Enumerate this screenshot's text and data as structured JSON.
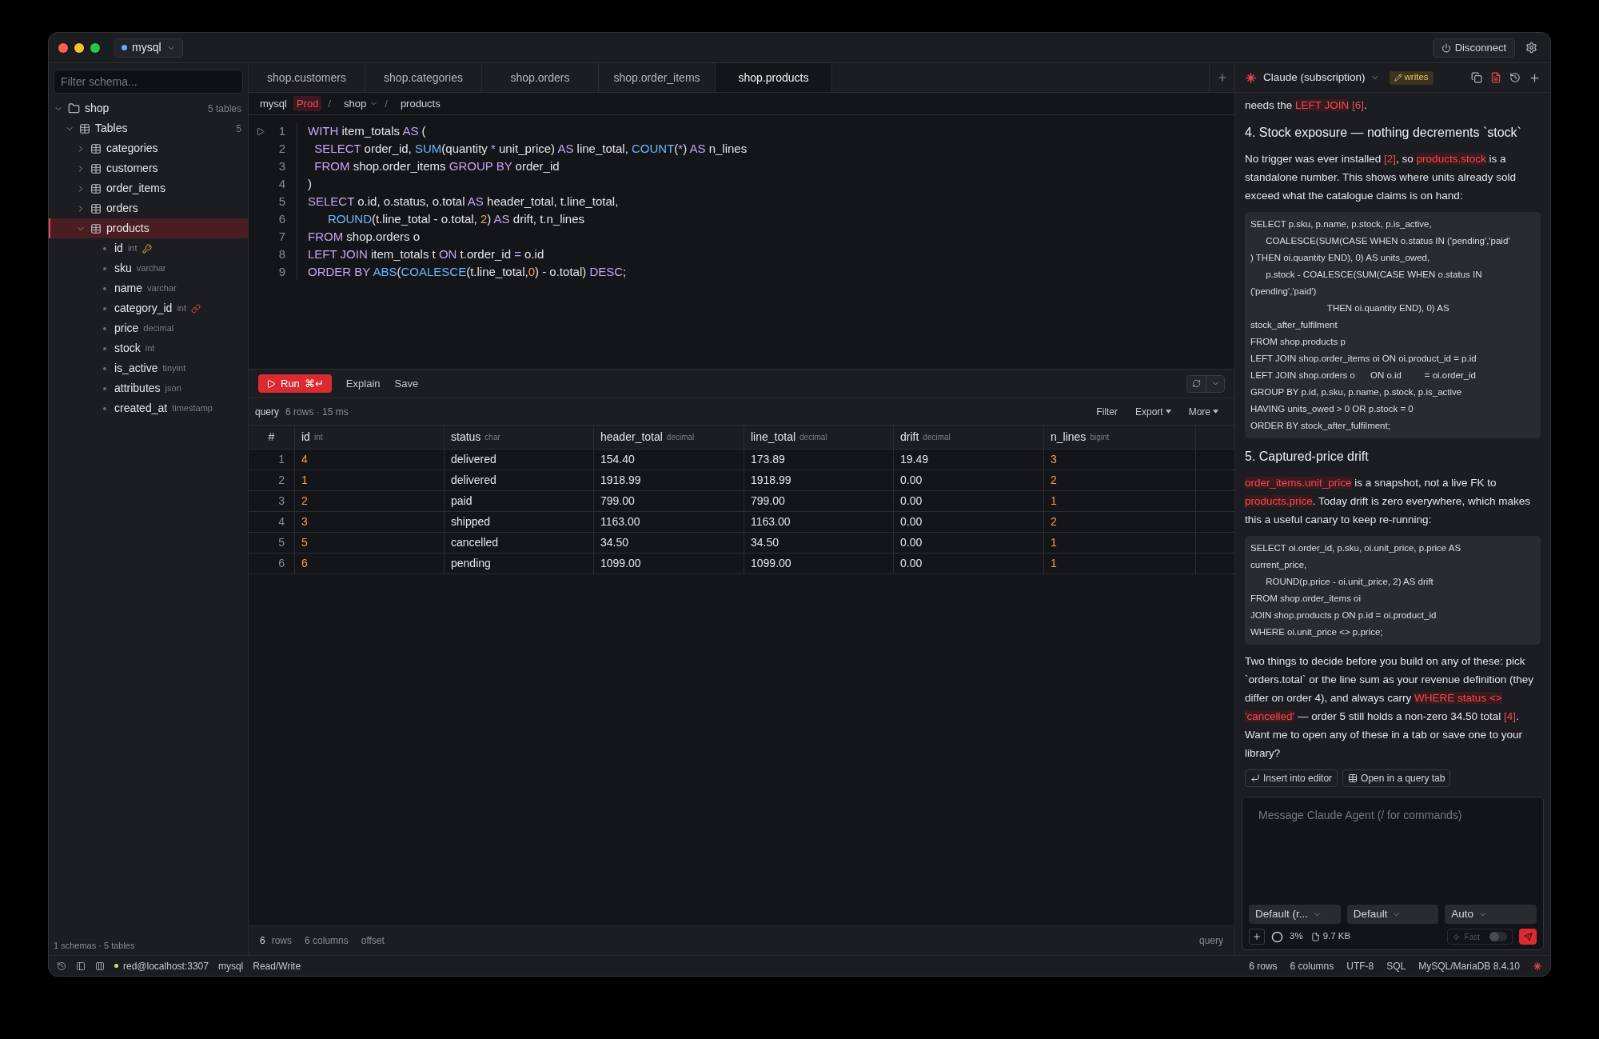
{
  "window": {
    "connection": "mysql",
    "disconnect_button": "Disconnect"
  },
  "sidebar": {
    "filter_placeholder": "Filter schema...",
    "footer": "1 schemas · 5 tables",
    "tree": [
      {
        "kind": "schema",
        "label": "shop",
        "count": "5 tables",
        "expanded": true,
        "selected": false,
        "children": [
          {
            "kind": "group",
            "label": "Tables",
            "count": "5",
            "expanded": true,
            "selected": false,
            "children": [
              {
                "kind": "table",
                "label": "categories",
                "expanded": false,
                "selected": false
              },
              {
                "kind": "table",
                "label": "customers",
                "expanded": false,
                "selected": false
              },
              {
                "kind": "table",
                "label": "order_items",
                "expanded": false,
                "selected": false
              },
              {
                "kind": "table",
                "label": "orders",
                "expanded": false,
                "selected": false
              },
              {
                "kind": "table",
                "label": "products",
                "expanded": true,
                "selected": true,
                "children": [
                  {
                    "kind": "primary_key_column",
                    "label": "id",
                    "type": "int"
                  },
                  {
                    "kind": "column",
                    "label": "sku",
                    "type": "varchar"
                  },
                  {
                    "kind": "column",
                    "label": "name",
                    "type": "varchar"
                  },
                  {
                    "kind": "foreign_key_column",
                    "label": "category_id",
                    "type": "int"
                  },
                  {
                    "kind": "column",
                    "label": "price",
                    "type": "decimal"
                  },
                  {
                    "kind": "column",
                    "label": "stock",
                    "type": "int"
                  },
                  {
                    "kind": "column",
                    "label": "is_active",
                    "type": "tinyint"
                  },
                  {
                    "kind": "column",
                    "label": "attributes",
                    "type": "json"
                  },
                  {
                    "kind": "column",
                    "label": "created_at",
                    "type": "timestamp"
                  }
                ]
              }
            ]
          }
        ]
      }
    ]
  },
  "tabs": [
    {
      "label": "shop.customers",
      "selected": false
    },
    {
      "label": "shop.categories",
      "selected": false
    },
    {
      "label": "shop.orders",
      "selected": false
    },
    {
      "label": "shop.order_items",
      "selected": false
    },
    {
      "label": "shop.products",
      "selected": true
    }
  ],
  "breadcrumb": [
    {
      "kind": "text",
      "text": "mysql"
    },
    {
      "kind": "badge",
      "text": "Prod"
    },
    {
      "kind": "separator",
      "text": "/"
    },
    {
      "kind": "dropdown",
      "text": "shop"
    },
    {
      "kind": "separator",
      "text": "/"
    },
    {
      "kind": "text",
      "text": "products"
    }
  ],
  "editor": {
    "lines": [
      {
        "number": "1",
        "runnable": true,
        "tokens": [
          {
            "kind": "keyword",
            "text": "WITH"
          },
          {
            "kind": "plain",
            "text": " item_totals "
          },
          {
            "kind": "keyword",
            "text": "AS"
          },
          {
            "kind": "plain",
            "text": " ("
          }
        ]
      },
      {
        "number": "2",
        "runnable": false,
        "tokens": [
          {
            "kind": "keyword",
            "text": "  SELECT"
          },
          {
            "kind": "plain",
            "text": " order_id, "
          },
          {
            "kind": "function",
            "text": "SUM"
          },
          {
            "kind": "plain",
            "text": "(quantity "
          },
          {
            "kind": "keyword",
            "text": "*"
          },
          {
            "kind": "plain",
            "text": " unit_price) "
          },
          {
            "kind": "keyword",
            "text": "AS"
          },
          {
            "kind": "plain",
            "text": " line_total, "
          },
          {
            "kind": "function",
            "text": "COUNT"
          },
          {
            "kind": "plain",
            "text": "("
          },
          {
            "kind": "keyword",
            "text": "*"
          },
          {
            "kind": "plain",
            "text": ") "
          },
          {
            "kind": "keyword",
            "text": "AS"
          },
          {
            "kind": "plain",
            "text": " n_lines"
          }
        ]
      },
      {
        "number": "3",
        "runnable": false,
        "tokens": [
          {
            "kind": "keyword",
            "text": "  FROM"
          },
          {
            "kind": "plain",
            "text": " shop.order_items "
          },
          {
            "kind": "keyword",
            "text": "GROUP BY"
          },
          {
            "kind": "plain",
            "text": " order_id"
          }
        ]
      },
      {
        "number": "4",
        "runnable": false,
        "tokens": [
          {
            "kind": "plain",
            "text": ")"
          }
        ]
      },
      {
        "number": "5",
        "runnable": false,
        "tokens": [
          {
            "kind": "keyword",
            "text": "SELECT"
          },
          {
            "kind": "plain",
            "text": " o.id, o.status, o.total "
          },
          {
            "kind": "keyword",
            "text": "AS"
          },
          {
            "kind": "plain",
            "text": " header_total, t.line_total,"
          }
        ]
      },
      {
        "number": "6",
        "runnable": false,
        "tokens": [
          {
            "kind": "function",
            "text": "      ROUND"
          },
          {
            "kind": "plain",
            "text": "(t.line_total - o.total, "
          },
          {
            "kind": "number",
            "text": "2"
          },
          {
            "kind": "plain",
            "text": ") "
          },
          {
            "kind": "keyword",
            "text": "AS"
          },
          {
            "kind": "plain",
            "text": " drift, t.n_lines"
          }
        ]
      },
      {
        "number": "7",
        "runnable": false,
        "tokens": [
          {
            "kind": "keyword",
            "text": "FROM"
          },
          {
            "kind": "plain",
            "text": " shop.orders o"
          }
        ]
      },
      {
        "number": "8",
        "runnable": false,
        "tokens": [
          {
            "kind": "keyword",
            "text": "LEFT JOIN"
          },
          {
            "kind": "plain",
            "text": " item_totals t "
          },
          {
            "kind": "keyword",
            "text": "ON"
          },
          {
            "kind": "plain",
            "text": " t.order_id "
          },
          {
            "kind": "keyword",
            "text": "="
          },
          {
            "kind": "plain",
            "text": " o.id"
          }
        ]
      },
      {
        "number": "9",
        "runnable": false,
        "tokens": [
          {
            "kind": "keyword",
            "text": "ORDER BY "
          },
          {
            "kind": "function",
            "text": "ABS"
          },
          {
            "kind": "plain",
            "text": "("
          },
          {
            "kind": "function",
            "text": "COALESCE"
          },
          {
            "kind": "plain",
            "text": "(t.line_total,"
          },
          {
            "kind": "number",
            "text": "0"
          },
          {
            "kind": "plain",
            "text": ") - o.total) "
          },
          {
            "kind": "keyword",
            "text": "DESC"
          },
          {
            "kind": "plain",
            "text": ";"
          }
        ]
      }
    ]
  },
  "toolbar": {
    "run": {
      "label": "Run",
      "shortcut": "⌘↵"
    },
    "buttons": [
      "Explain",
      "Save"
    ]
  },
  "results": {
    "label": "query",
    "summary": "6 rows · 15 ms",
    "actions": [
      {
        "label": "Filter",
        "menu": false
      },
      {
        "label": "Export",
        "menu": true
      },
      {
        "label": "More",
        "menu": true
      }
    ],
    "index_header": "#",
    "columns": [
      {
        "name": "id",
        "type": "int",
        "kind": "integer"
      },
      {
        "name": "status",
        "type": "char",
        "kind": "text"
      },
      {
        "name": "header_total",
        "type": "decimal",
        "kind": "text"
      },
      {
        "name": "line_total",
        "type": "decimal",
        "kind": "text"
      },
      {
        "name": "drift",
        "type": "decimal",
        "kind": "text"
      },
      {
        "name": "n_lines",
        "type": "bigint",
        "kind": "integer"
      }
    ],
    "rows": [
      {
        "number": "1",
        "cells": [
          "4",
          "delivered",
          "154.40",
          "173.89",
          "19.49",
          "3"
        ]
      },
      {
        "number": "2",
        "cells": [
          "1",
          "delivered",
          "1918.99",
          "1918.99",
          "0.00",
          "2"
        ]
      },
      {
        "number": "3",
        "cells": [
          "2",
          "paid",
          "799.00",
          "799.00",
          "0.00",
          "1"
        ]
      },
      {
        "number": "4",
        "cells": [
          "3",
          "shipped",
          "1163.00",
          "1163.00",
          "0.00",
          "2"
        ]
      },
      {
        "number": "5",
        "cells": [
          "5",
          "cancelled",
          "34.50",
          "34.50",
          "0.00",
          "1"
        ]
      },
      {
        "number": "6",
        "cells": [
          "6",
          "pending",
          "1099.00",
          "1099.00",
          "0.00",
          "1"
        ]
      }
    ],
    "footer": {
      "row_count": "6",
      "rows_label": "rows",
      "columns": "6 columns",
      "offset": "offset",
      "mode": "query"
    }
  },
  "assistant": {
    "model": "Claude (subscription)",
    "badge": "writes",
    "blocks": [
      {
        "kind": "paragraph",
        "segments": [
          {
            "kind": "text",
            "text": "needs the "
          },
          {
            "kind": "code",
            "text": "LEFT JOIN"
          },
          {
            "kind": "cite",
            "text": " [6]"
          },
          {
            "kind": "text",
            "text": "."
          }
        ]
      },
      {
        "kind": "heading",
        "text": "4. Stock exposure — nothing decrements `stock`"
      },
      {
        "kind": "paragraph",
        "segments": [
          {
            "kind": "text",
            "text": "No trigger was ever installed "
          },
          {
            "kind": "cite",
            "text": "[2]"
          },
          {
            "kind": "text",
            "text": ", so "
          },
          {
            "kind": "code",
            "text": "products.stock"
          },
          {
            "kind": "text",
            "text": " is a standalone number. This shows where units already sold exceed what the catalogue claims is on hand:"
          }
        ]
      },
      {
        "kind": "code",
        "lines": [
          "SELECT p.sku, p.name, p.stock, p.is_active,",
          "      COALESCE(SUM(CASE WHEN o.status IN ('pending','paid'",
          ") THEN oi.quantity END), 0) AS units_owed,",
          "      p.stock - COALESCE(SUM(CASE WHEN o.status IN",
          "('pending','paid')",
          "                              THEN oi.quantity END), 0) AS",
          "stock_after_fulfilment",
          "FROM shop.products p",
          "LEFT JOIN shop.order_items oi ON oi.product_id = p.id",
          "LEFT JOIN shop.orders o      ON o.id         = oi.order_id",
          "GROUP BY p.id, p.sku, p.name, p.stock, p.is_active",
          "HAVING units_owed > 0 OR p.stock = 0",
          "ORDER BY stock_after_fulfilment;"
        ]
      },
      {
        "kind": "heading",
        "text": "5. Captured-price drift"
      },
      {
        "kind": "paragraph",
        "segments": [
          {
            "kind": "code",
            "text": "order_items.unit_price"
          },
          {
            "kind": "text",
            "text": " is a snapshot, not a live FK to "
          },
          {
            "kind": "code",
            "text": "products.price"
          },
          {
            "kind": "text",
            "text": ". Today drift is zero everywhere, which makes this a useful canary to keep re-running:"
          }
        ]
      },
      {
        "kind": "code",
        "lines": [
          "SELECT oi.order_id, p.sku, oi.unit_price, p.price AS",
          "current_price,",
          "      ROUND(p.price - oi.unit_price, 2) AS drift",
          "FROM shop.order_items oi",
          "JOIN shop.products p ON p.id = oi.product_id",
          "WHERE oi.unit_price <> p.price;"
        ]
      },
      {
        "kind": "paragraph",
        "segments": [
          {
            "kind": "text",
            "text": "Two things to decide before you build on any of these: pick `orders.total` or the line sum as your revenue definition (they differ on order 4), and always carry "
          },
          {
            "kind": "code",
            "text": "WHERE status <> 'cancelled'"
          },
          {
            "kind": "text",
            "text": " — order 5 still holds a non-zero 34.50 total "
          },
          {
            "kind": "cite",
            "text": "[4]"
          },
          {
            "kind": "text",
            "text": ". Want me to open any of these in a tab or save one to your library?"
          }
        ]
      },
      {
        "kind": "actions",
        "buttons": [
          {
            "kind": "insert",
            "label": "Insert into editor"
          },
          {
            "kind": "open_tab",
            "label": "Open in a query tab"
          }
        ]
      }
    ],
    "composer": {
      "placeholder": "Message Claude Agent (/ for commands)",
      "selects": [
        "Default (r...",
        "Default",
        "Auto"
      ],
      "context": "3%",
      "size": "9.7 KB",
      "fast": {
        "label": "Fast",
        "on": false
      }
    }
  },
  "status_bar": {
    "connection": "red@localhost:3307",
    "driver": "mysql",
    "mode": "Read/Write",
    "right": [
      "6 rows",
      "6 columns",
      "UTF-8",
      "SQL",
      "MySQL/MariaDB 8.4.10"
    ]
  }
}
